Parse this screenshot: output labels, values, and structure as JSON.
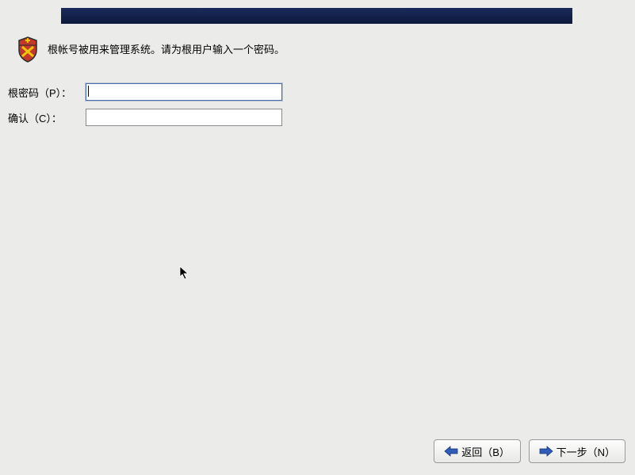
{
  "description": "根帐号被用来管理系统。请为根用户输入一个密码。",
  "form": {
    "password_label": "根密码（P）：",
    "confirm_label": "确认（C）：",
    "password_value": "",
    "confirm_value": ""
  },
  "buttons": {
    "back_label": "返回（B）",
    "next_label": "下一步（N）"
  },
  "icons": {
    "shield": "shield-icon",
    "arrow_left": "arrow-left-icon",
    "arrow_right": "arrow-right-icon"
  },
  "colors": {
    "header_bg": "#0d1a3d",
    "page_bg": "#ebebe9",
    "button_border": "#9a9a98",
    "arrow_blue": "#2e5cb8"
  }
}
